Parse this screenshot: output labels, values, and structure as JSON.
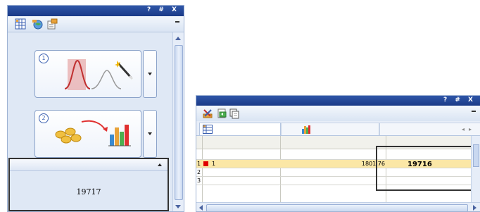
{
  "left_panel": {
    "title_buttons": "? # X",
    "toolbar_icons": [
      "grid-icon",
      "globe-add-icon",
      "properties-icon"
    ],
    "steps": [
      {
        "number": "1",
        "icon": "curve-wand-icon"
      },
      {
        "number": "2",
        "icon": "data-to-chart-icon"
      }
    ],
    "value_box": {
      "value": "19717"
    }
  },
  "right_panel": {
    "title_buttons": "? # X",
    "toolbar_icons": [
      "tools-icon",
      "export-icon",
      "copy-icon"
    ],
    "tabs": [
      {
        "icon": "table-icon"
      },
      {
        "icon": "chart-icon"
      }
    ],
    "rows": [
      {
        "num": "1",
        "id": "1",
        "value": "1801,76",
        "highlight_value": "19716"
      },
      {
        "num": "2"
      },
      {
        "num": "3"
      }
    ]
  },
  "colors": {
    "title_bar": "#1a3a87",
    "panel_bg": "#dfe8f5",
    "selected_row": "#fbe7a6",
    "marker": "#e00000"
  }
}
